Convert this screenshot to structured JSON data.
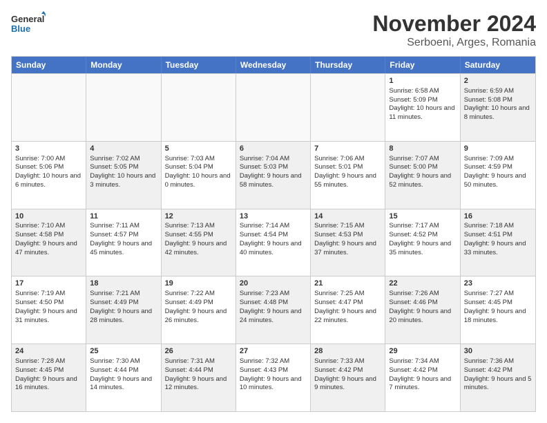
{
  "logo": {
    "line1": "General",
    "line2": "Blue"
  },
  "title": "November 2024",
  "subtitle": "Serboeni, Arges, Romania",
  "weekdays": [
    "Sunday",
    "Monday",
    "Tuesday",
    "Wednesday",
    "Thursday",
    "Friday",
    "Saturday"
  ],
  "rows": [
    [
      {
        "day": "",
        "info": "",
        "shaded": false,
        "empty": true
      },
      {
        "day": "",
        "info": "",
        "shaded": false,
        "empty": true
      },
      {
        "day": "",
        "info": "",
        "shaded": false,
        "empty": true
      },
      {
        "day": "",
        "info": "",
        "shaded": false,
        "empty": true
      },
      {
        "day": "",
        "info": "",
        "shaded": false,
        "empty": true
      },
      {
        "day": "1",
        "info": "Sunrise: 6:58 AM\nSunset: 5:09 PM\nDaylight: 10 hours and 11 minutes.",
        "shaded": false,
        "empty": false
      },
      {
        "day": "2",
        "info": "Sunrise: 6:59 AM\nSunset: 5:08 PM\nDaylight: 10 hours and 8 minutes.",
        "shaded": true,
        "empty": false
      }
    ],
    [
      {
        "day": "3",
        "info": "Sunrise: 7:00 AM\nSunset: 5:06 PM\nDaylight: 10 hours and 6 minutes.",
        "shaded": false,
        "empty": false
      },
      {
        "day": "4",
        "info": "Sunrise: 7:02 AM\nSunset: 5:05 PM\nDaylight: 10 hours and 3 minutes.",
        "shaded": true,
        "empty": false
      },
      {
        "day": "5",
        "info": "Sunrise: 7:03 AM\nSunset: 5:04 PM\nDaylight: 10 hours and 0 minutes.",
        "shaded": false,
        "empty": false
      },
      {
        "day": "6",
        "info": "Sunrise: 7:04 AM\nSunset: 5:03 PM\nDaylight: 9 hours and 58 minutes.",
        "shaded": true,
        "empty": false
      },
      {
        "day": "7",
        "info": "Sunrise: 7:06 AM\nSunset: 5:01 PM\nDaylight: 9 hours and 55 minutes.",
        "shaded": false,
        "empty": false
      },
      {
        "day": "8",
        "info": "Sunrise: 7:07 AM\nSunset: 5:00 PM\nDaylight: 9 hours and 52 minutes.",
        "shaded": true,
        "empty": false
      },
      {
        "day": "9",
        "info": "Sunrise: 7:09 AM\nSunset: 4:59 PM\nDaylight: 9 hours and 50 minutes.",
        "shaded": false,
        "empty": false
      }
    ],
    [
      {
        "day": "10",
        "info": "Sunrise: 7:10 AM\nSunset: 4:58 PM\nDaylight: 9 hours and 47 minutes.",
        "shaded": true,
        "empty": false
      },
      {
        "day": "11",
        "info": "Sunrise: 7:11 AM\nSunset: 4:57 PM\nDaylight: 9 hours and 45 minutes.",
        "shaded": false,
        "empty": false
      },
      {
        "day": "12",
        "info": "Sunrise: 7:13 AM\nSunset: 4:55 PM\nDaylight: 9 hours and 42 minutes.",
        "shaded": true,
        "empty": false
      },
      {
        "day": "13",
        "info": "Sunrise: 7:14 AM\nSunset: 4:54 PM\nDaylight: 9 hours and 40 minutes.",
        "shaded": false,
        "empty": false
      },
      {
        "day": "14",
        "info": "Sunrise: 7:15 AM\nSunset: 4:53 PM\nDaylight: 9 hours and 37 minutes.",
        "shaded": true,
        "empty": false
      },
      {
        "day": "15",
        "info": "Sunrise: 7:17 AM\nSunset: 4:52 PM\nDaylight: 9 hours and 35 minutes.",
        "shaded": false,
        "empty": false
      },
      {
        "day": "16",
        "info": "Sunrise: 7:18 AM\nSunset: 4:51 PM\nDaylight: 9 hours and 33 minutes.",
        "shaded": true,
        "empty": false
      }
    ],
    [
      {
        "day": "17",
        "info": "Sunrise: 7:19 AM\nSunset: 4:50 PM\nDaylight: 9 hours and 31 minutes.",
        "shaded": false,
        "empty": false
      },
      {
        "day": "18",
        "info": "Sunrise: 7:21 AM\nSunset: 4:49 PM\nDaylight: 9 hours and 28 minutes.",
        "shaded": true,
        "empty": false
      },
      {
        "day": "19",
        "info": "Sunrise: 7:22 AM\nSunset: 4:49 PM\nDaylight: 9 hours and 26 minutes.",
        "shaded": false,
        "empty": false
      },
      {
        "day": "20",
        "info": "Sunrise: 7:23 AM\nSunset: 4:48 PM\nDaylight: 9 hours and 24 minutes.",
        "shaded": true,
        "empty": false
      },
      {
        "day": "21",
        "info": "Sunrise: 7:25 AM\nSunset: 4:47 PM\nDaylight: 9 hours and 22 minutes.",
        "shaded": false,
        "empty": false
      },
      {
        "day": "22",
        "info": "Sunrise: 7:26 AM\nSunset: 4:46 PM\nDaylight: 9 hours and 20 minutes.",
        "shaded": true,
        "empty": false
      },
      {
        "day": "23",
        "info": "Sunrise: 7:27 AM\nSunset: 4:45 PM\nDaylight: 9 hours and 18 minutes.",
        "shaded": false,
        "empty": false
      }
    ],
    [
      {
        "day": "24",
        "info": "Sunrise: 7:28 AM\nSunset: 4:45 PM\nDaylight: 9 hours and 16 minutes.",
        "shaded": true,
        "empty": false
      },
      {
        "day": "25",
        "info": "Sunrise: 7:30 AM\nSunset: 4:44 PM\nDaylight: 9 hours and 14 minutes.",
        "shaded": false,
        "empty": false
      },
      {
        "day": "26",
        "info": "Sunrise: 7:31 AM\nSunset: 4:44 PM\nDaylight: 9 hours and 12 minutes.",
        "shaded": true,
        "empty": false
      },
      {
        "day": "27",
        "info": "Sunrise: 7:32 AM\nSunset: 4:43 PM\nDaylight: 9 hours and 10 minutes.",
        "shaded": false,
        "empty": false
      },
      {
        "day": "28",
        "info": "Sunrise: 7:33 AM\nSunset: 4:42 PM\nDaylight: 9 hours and 9 minutes.",
        "shaded": true,
        "empty": false
      },
      {
        "day": "29",
        "info": "Sunrise: 7:34 AM\nSunset: 4:42 PM\nDaylight: 9 hours and 7 minutes.",
        "shaded": false,
        "empty": false
      },
      {
        "day": "30",
        "info": "Sunrise: 7:36 AM\nSunset: 4:42 PM\nDaylight: 9 hours and 5 minutes.",
        "shaded": true,
        "empty": false
      }
    ]
  ]
}
